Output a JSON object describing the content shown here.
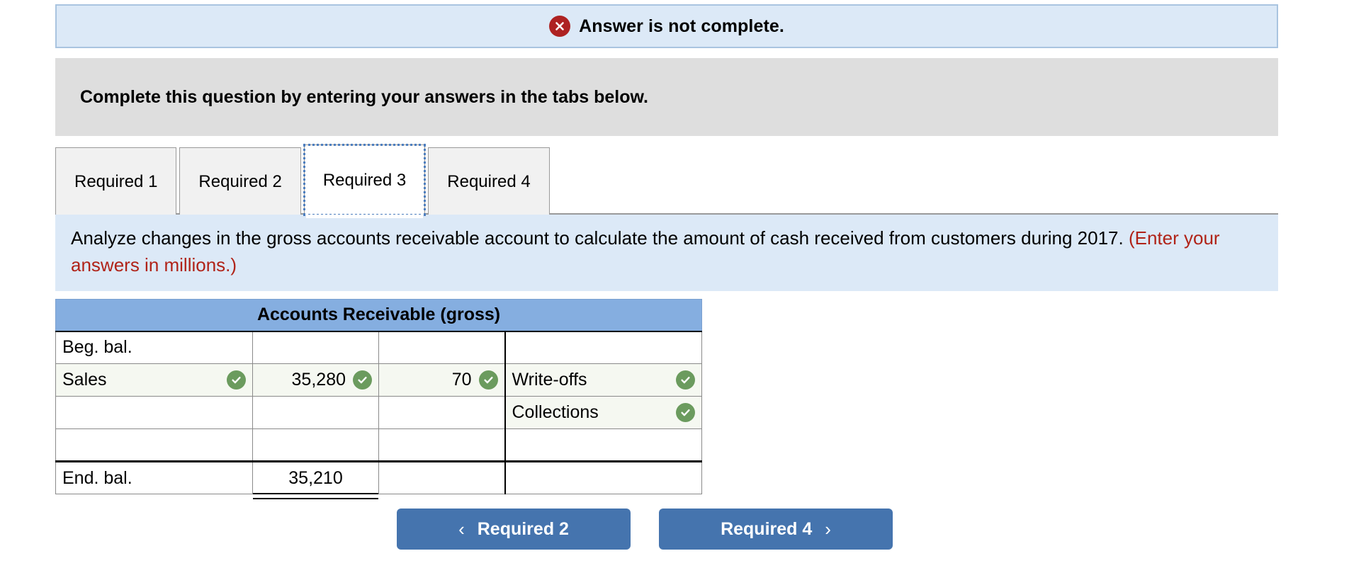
{
  "alert": {
    "icon": "error-x-icon",
    "text": "Answer is not complete.",
    "icon_color": "#ae2222",
    "background": "#dce9f7"
  },
  "instruction_bar": {
    "text": "Complete this question by entering your answers in the tabs below.",
    "background": "#dedede"
  },
  "tabs": {
    "items": [
      {
        "label": "Required 1",
        "selected": false
      },
      {
        "label": "Required 2",
        "selected": false
      },
      {
        "label": "Required 3",
        "selected": true
      },
      {
        "label": "Required 4",
        "selected": false
      }
    ],
    "selected_index": 2,
    "focus_outline_color": "#4e7fbf"
  },
  "question": {
    "main": "Analyze changes in the gross accounts receivable account to calculate the amount of cash received from customers during 2017.",
    "note": "(Enter your answers in millions.)",
    "note_color": "#b02318",
    "background": "#dce9f7"
  },
  "taccount": {
    "title": "Accounts Receivable (gross)",
    "title_background": "#85aee0",
    "check_color": "#6b9b5e",
    "graded_row_background": "#f5f8f1",
    "rows": [
      {
        "label_left": "Beg. bal.",
        "left_check": false,
        "debit": "",
        "debit_check": false,
        "credit": "",
        "credit_check": false,
        "label_right": "",
        "right_check": false,
        "graded": false
      },
      {
        "label_left": "Sales",
        "left_check": true,
        "debit": "35,280",
        "debit_check": true,
        "credit": "70",
        "credit_check": true,
        "label_right": "Write-offs",
        "right_check": true,
        "graded": true
      },
      {
        "label_left": "",
        "left_check": false,
        "debit": "",
        "debit_check": false,
        "credit": "",
        "credit_check": false,
        "label_right": "Collections",
        "right_check": true,
        "graded": false
      },
      {
        "label_left": "",
        "left_check": false,
        "debit": "",
        "debit_check": false,
        "credit": "",
        "credit_check": false,
        "label_right": "",
        "right_check": false,
        "graded": false
      }
    ],
    "ending": {
      "label": "End. bal.",
      "value": "35,210",
      "credit": "",
      "label_right": ""
    }
  },
  "nav": {
    "prev_label": "Required 2",
    "prev_chevron": "chevron-left-icon",
    "next_label": "Required 4",
    "next_chevron": "chevron-right-icon",
    "button_color": "#4574ae"
  }
}
